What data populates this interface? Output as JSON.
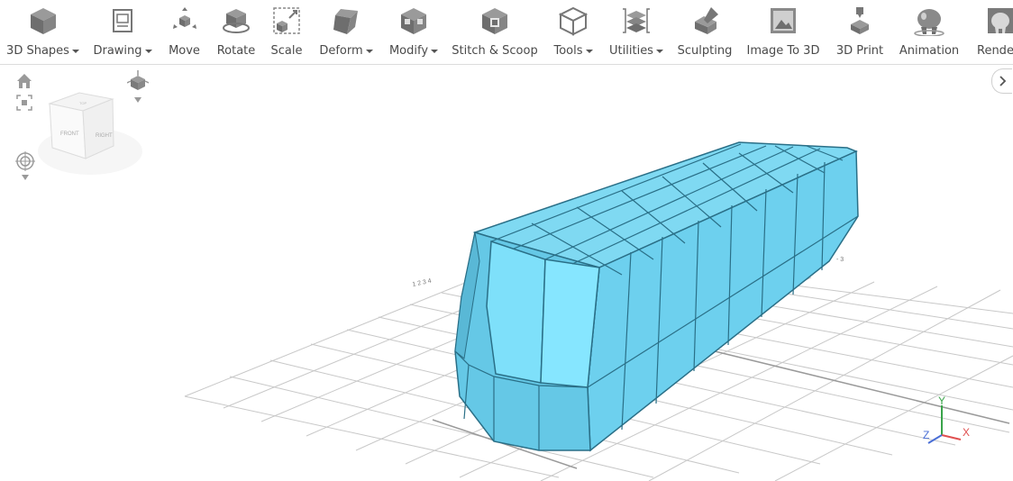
{
  "toolbar": {
    "items": [
      {
        "label": "3D Shapes",
        "icon": "cube-icon",
        "dropdown": true
      },
      {
        "label": "Drawing",
        "icon": "drawing-icon",
        "dropdown": true
      },
      {
        "label": "Move",
        "icon": "move-icon",
        "dropdown": false
      },
      {
        "label": "Rotate",
        "icon": "rotate-icon",
        "dropdown": false
      },
      {
        "label": "Scale",
        "icon": "scale-icon",
        "dropdown": false
      },
      {
        "label": "Deform",
        "icon": "deform-icon",
        "dropdown": true
      },
      {
        "label": "Modify",
        "icon": "modify-icon",
        "dropdown": true
      },
      {
        "label": "Stitch & Scoop",
        "icon": "stitch-scoop-icon",
        "dropdown": false
      },
      {
        "label": "Tools",
        "icon": "tools-icon",
        "dropdown": true
      },
      {
        "label": "Utilities",
        "icon": "utilities-icon",
        "dropdown": true
      },
      {
        "label": "Sculpting",
        "icon": "sculpting-icon",
        "dropdown": false
      },
      {
        "label": "Image To 3D",
        "icon": "image-to-3d-icon",
        "dropdown": false
      },
      {
        "label": "3D Print",
        "icon": "3d-print-icon",
        "dropdown": false
      },
      {
        "label": "Animation",
        "icon": "animation-icon",
        "dropdown": false
      },
      {
        "label": "Rende",
        "icon": "render-icon",
        "dropdown": false
      }
    ]
  },
  "viewcube": {
    "front_label": "FRONT",
    "right_label": "RIGHT",
    "top_label": "TOP"
  },
  "axes": {
    "x_label": "X",
    "y_label": "Y",
    "z_label": "Z"
  },
  "colors": {
    "model_fill": "#6dd0ee",
    "model_edge": "#2a6f87",
    "grid": "#c8c8c8",
    "axis_x": "#e05050",
    "axis_y": "#3aa34a",
    "axis_z": "#4a6fd6",
    "icon_gray": "#7a7a7a"
  }
}
